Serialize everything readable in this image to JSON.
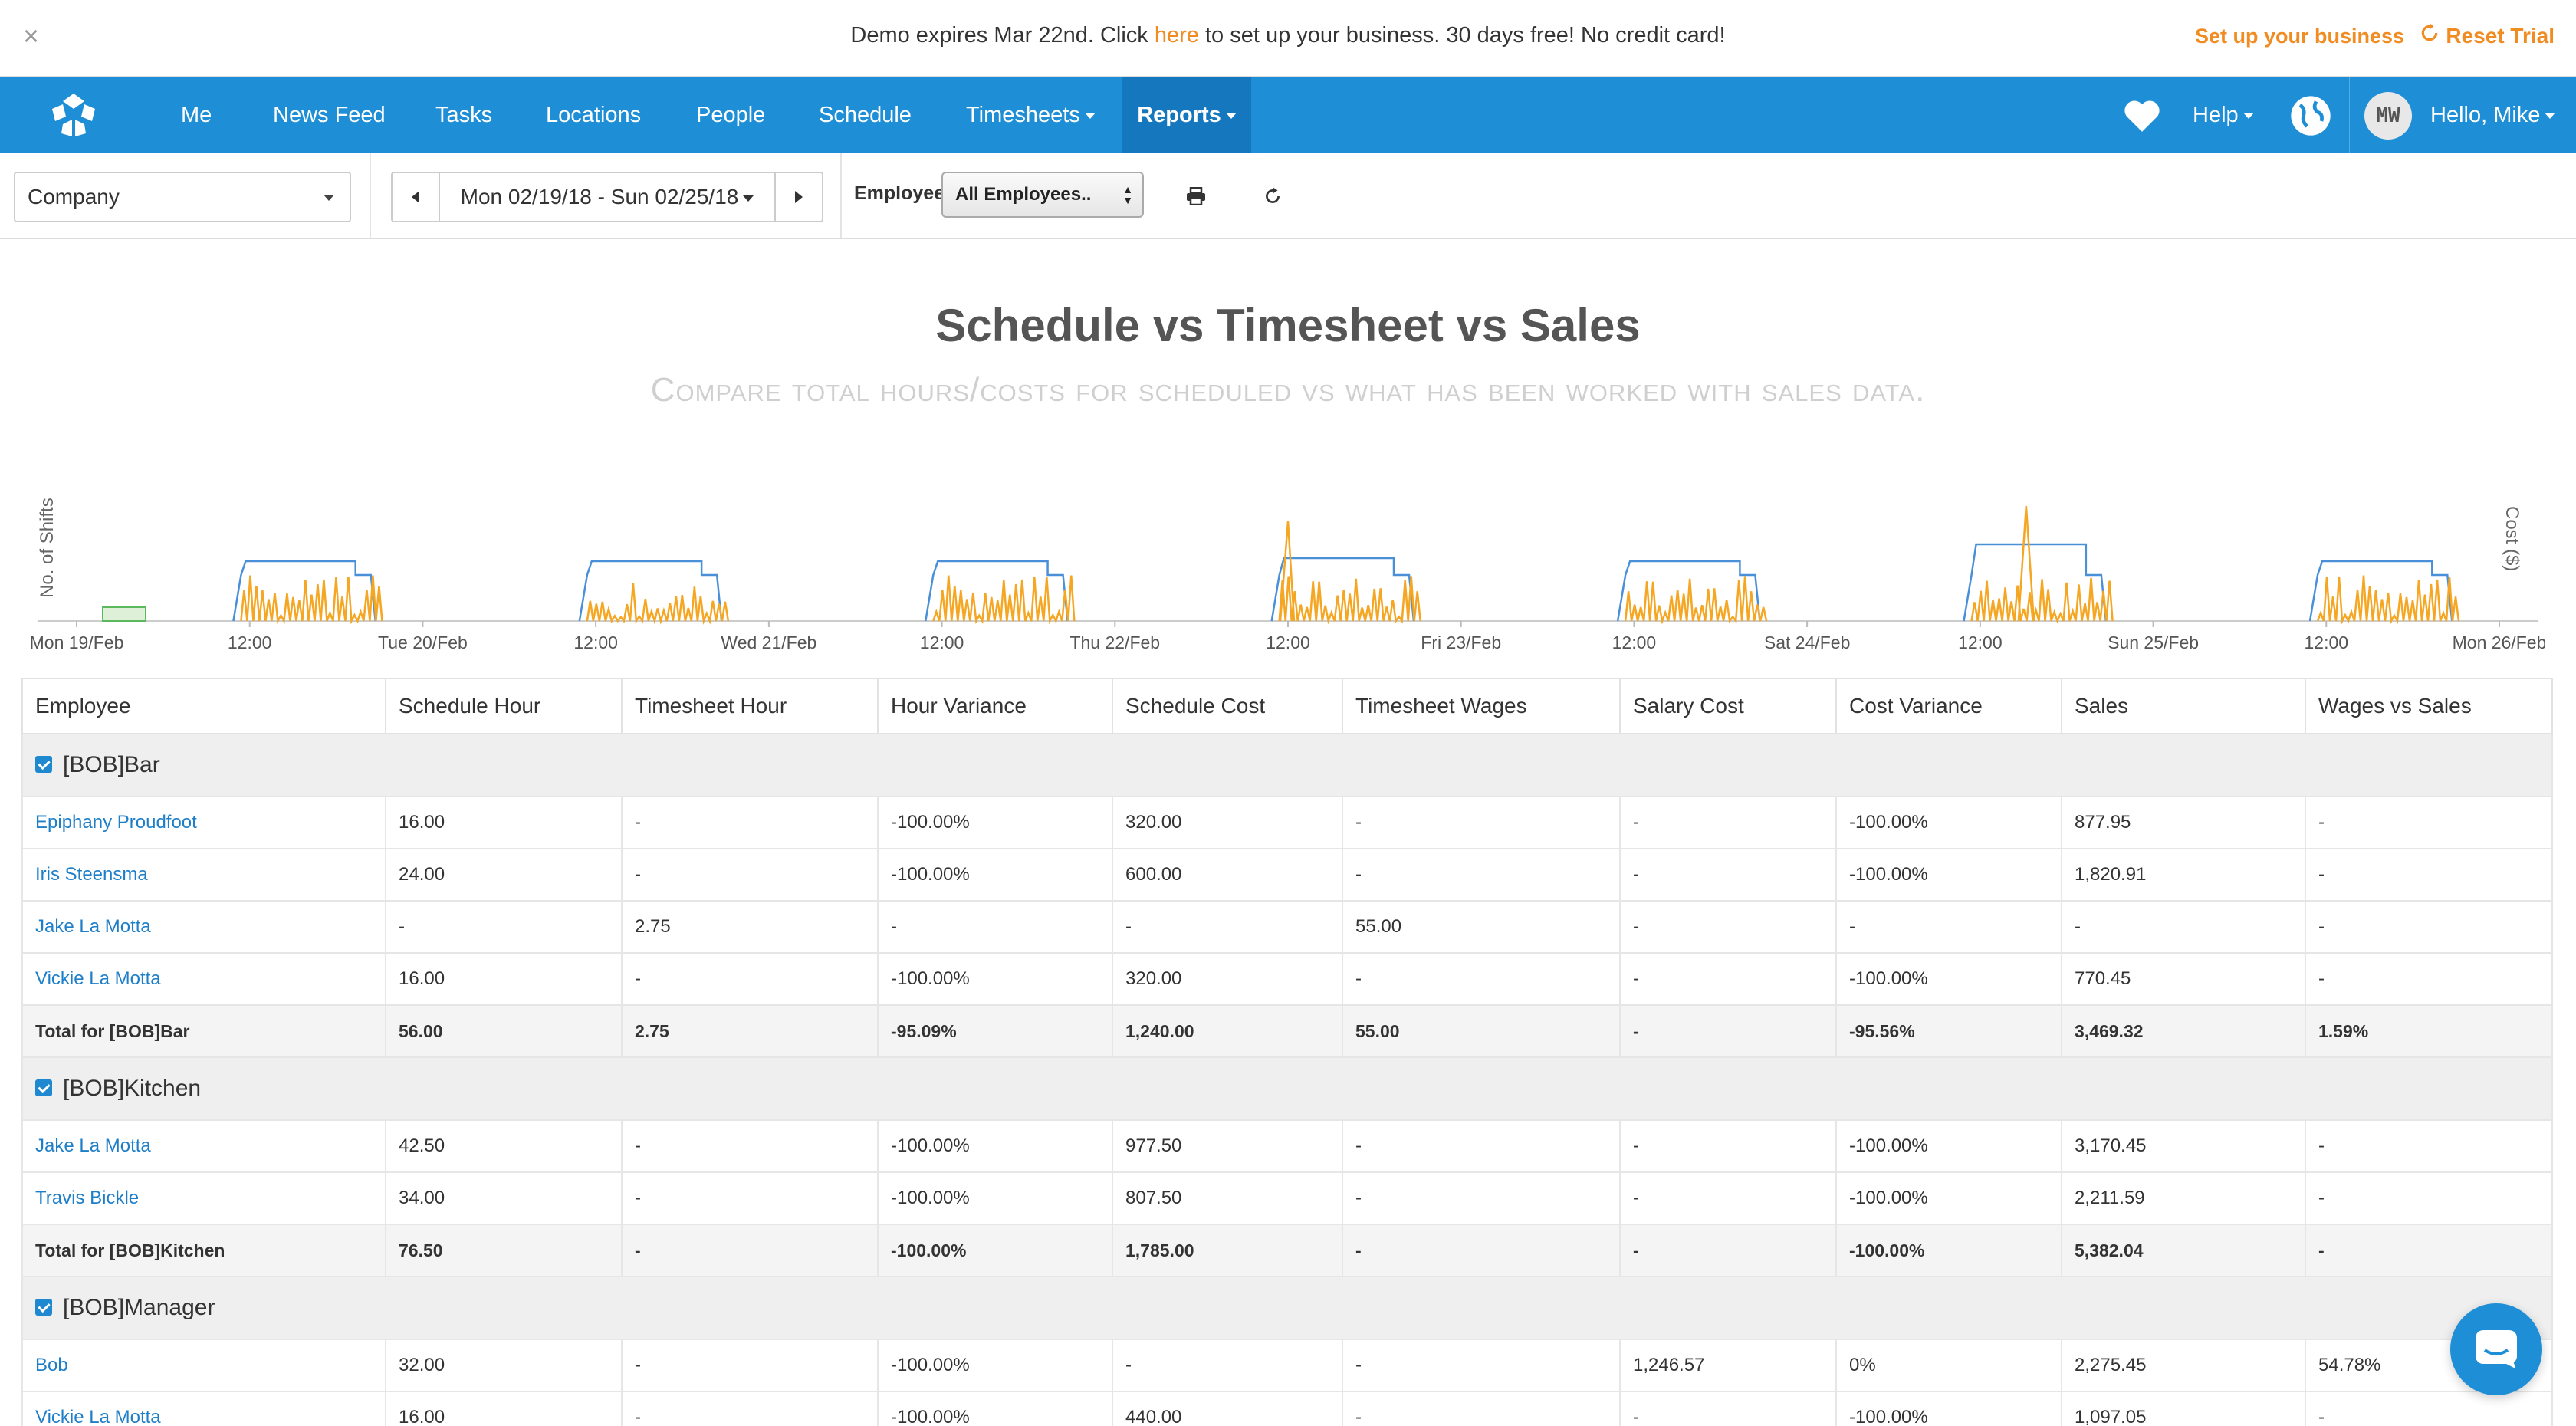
{
  "banner": {
    "close": "×",
    "message_pre": "Demo expires Mar 22nd. Click ",
    "message_link": "here",
    "message_post": " to set up your business. 30 days free! No credit card!",
    "setup": "Set up your business",
    "reset": "Reset Trial"
  },
  "nav": {
    "items": [
      "Me",
      "News Feed",
      "Tasks",
      "Locations",
      "People",
      "Schedule",
      "Timesheets",
      "Reports"
    ],
    "help": "Help",
    "avatar": "MW",
    "greeting": "Hello, Mike",
    "accent": "#1e8fd6"
  },
  "toolbar": {
    "company": "Company",
    "date_range": "Mon 02/19/18 - Sun 02/25/18",
    "employee_label": "Employee",
    "employee_value": "All Employees.."
  },
  "report": {
    "title": "Schedule vs Timesheet vs Sales",
    "subtitle": "Compare total hours/costs for scheduled vs what has been worked with sales data."
  },
  "chart_data": {
    "type": "line",
    "ylabel": "No. of Shifts",
    "y2label": "Cost ($)",
    "tick_labels": [
      "Mon 19/Feb",
      "12:00",
      "Tue 20/Feb",
      "12:00",
      "Wed 21/Feb",
      "12:00",
      "Thu 22/Feb",
      "12:00",
      "Fri 23/Feb",
      "12:00",
      "Sat 24/Feb",
      "12:00",
      "Sun 25/Feb",
      "12:00",
      "Mon 26/Feb"
    ],
    "series": [
      {
        "kind": "schedule",
        "color": "#4a90d9"
      },
      {
        "kind": "sales",
        "color": "#f5a623"
      },
      {
        "kind": "timesheet",
        "color": "#5cb85c"
      }
    ]
  },
  "table": {
    "headers": [
      "Employee",
      "Schedule Hour",
      "Timesheet Hour",
      "Hour Variance",
      "Schedule Cost",
      "Timesheet Wages",
      "Salary Cost",
      "Cost Variance",
      "Sales",
      "Wages vs Sales"
    ],
    "rows": [
      {
        "type": "group",
        "label": "[BOB]Bar"
      },
      {
        "type": "emp",
        "cells": [
          "Epiphany Proudfoot",
          "16.00",
          "-",
          "-100.00%",
          "320.00",
          "-",
          "-",
          "-100.00%",
          "877.95",
          "-"
        ]
      },
      {
        "type": "emp",
        "cells": [
          "Iris Steensma",
          "24.00",
          "-",
          "-100.00%",
          "600.00",
          "-",
          "-",
          "-100.00%",
          "1,820.91",
          "-"
        ]
      },
      {
        "type": "emp",
        "cells": [
          "Jake La Motta",
          "-",
          "2.75",
          "-",
          "-",
          "55.00",
          "-",
          "-",
          "-",
          "-"
        ]
      },
      {
        "type": "emp",
        "cells": [
          "Vickie La Motta",
          "16.00",
          "-",
          "-100.00%",
          "320.00",
          "-",
          "-",
          "-100.00%",
          "770.45",
          "-"
        ]
      },
      {
        "type": "total",
        "cells": [
          "Total for [BOB]Bar",
          "56.00",
          "2.75",
          "-95.09%",
          "1,240.00",
          "55.00",
          "-",
          "-95.56%",
          "3,469.32",
          "1.59%"
        ]
      },
      {
        "type": "group",
        "label": "[BOB]Kitchen"
      },
      {
        "type": "emp",
        "cells": [
          "Jake La Motta",
          "42.50",
          "-",
          "-100.00%",
          "977.50",
          "-",
          "-",
          "-100.00%",
          "3,170.45",
          "-"
        ]
      },
      {
        "type": "emp",
        "cells": [
          "Travis Bickle",
          "34.00",
          "-",
          "-100.00%",
          "807.50",
          "-",
          "-",
          "-100.00%",
          "2,211.59",
          "-"
        ]
      },
      {
        "type": "total",
        "cells": [
          "Total for [BOB]Kitchen",
          "76.50",
          "-",
          "-100.00%",
          "1,785.00",
          "-",
          "-",
          "-100.00%",
          "5,382.04",
          "-"
        ]
      },
      {
        "type": "group",
        "label": "[BOB]Manager"
      },
      {
        "type": "emp",
        "cells": [
          "Bob",
          "32.00",
          "-",
          "-100.00%",
          "-",
          "-",
          "1,246.57",
          "0%",
          "2,275.45",
          "54.78%"
        ]
      },
      {
        "type": "emp",
        "cells": [
          "Vickie La Motta",
          "16.00",
          "-",
          "-100.00%",
          "440.00",
          "-",
          "-",
          "-100.00%",
          "1,097.05",
          "-"
        ]
      }
    ]
  }
}
